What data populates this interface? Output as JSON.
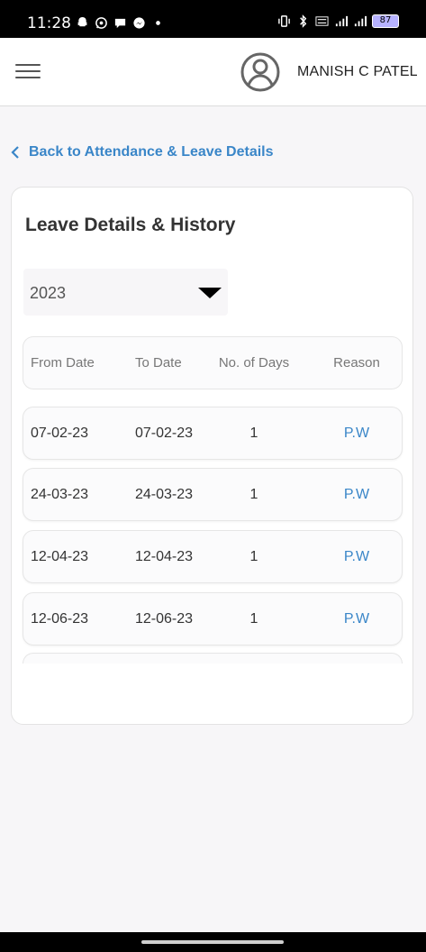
{
  "status_bar": {
    "time": "11:28",
    "battery": "87",
    "left_icons": [
      "snapchat-icon",
      "whatsapp-icon",
      "chat-icon",
      "messenger-icon",
      "dot-icon"
    ],
    "right_icons": [
      "vibrate-icon",
      "bluetooth-icon",
      "volte-icon",
      "5g-signal-icon",
      "signal-icon"
    ]
  },
  "header": {
    "menu_icon": "hamburger-icon",
    "avatar_icon": "user-avatar-icon",
    "user_name": "MANISH C PATEL"
  },
  "back_link": {
    "label": "Back to Attendance & Leave Details",
    "icon": "chevron-left-icon"
  },
  "card": {
    "title": "Leave Details & History",
    "year_select": {
      "value": "2023",
      "icon": "caret-down-icon"
    },
    "table": {
      "columns": [
        "From Date",
        "To Date",
        "No. of Days",
        "Reason"
      ],
      "rows": [
        {
          "from": "07-02-23",
          "to": "07-02-23",
          "days": "1",
          "reason": "P.W"
        },
        {
          "from": "24-03-23",
          "to": "24-03-23",
          "days": "1",
          "reason": "P.W"
        },
        {
          "from": "12-04-23",
          "to": "12-04-23",
          "days": "1",
          "reason": "P.W"
        },
        {
          "from": "12-06-23",
          "to": "12-06-23",
          "days": "1",
          "reason": "P.W"
        }
      ]
    }
  },
  "colors": {
    "accent": "#3a86c8",
    "background": "#f7f6f8",
    "card": "#ffffff"
  }
}
